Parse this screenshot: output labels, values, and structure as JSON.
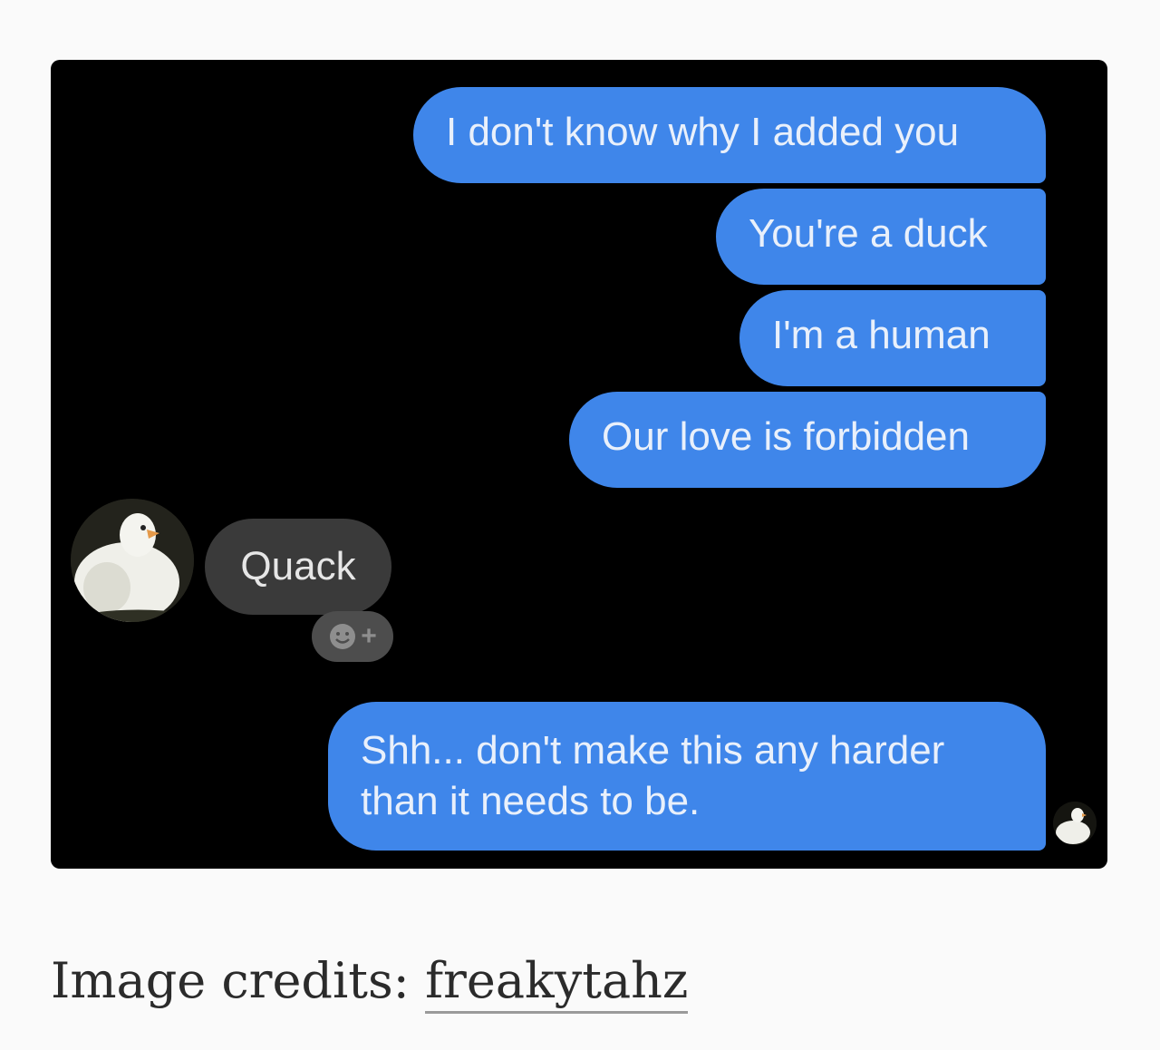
{
  "messages": {
    "outgoing": [
      "I don't know why I added you",
      "You're a duck",
      "I'm a human",
      "Our love is forbidden"
    ],
    "incoming": "Quack",
    "final_outgoing": "Shh... don't make this any harder than it needs to be."
  },
  "icons": {
    "contact_avatar": "duck-avatar-icon",
    "seen_avatar": "duck-seen-icon",
    "reaction": "add-reaction-icon"
  },
  "reaction_plus": "+",
  "caption": {
    "label": "Image credits:",
    "credit": "freakytahz"
  },
  "colors": {
    "outgoing_bubble": "#3f86ea",
    "incoming_bubble": "#3a3a3a",
    "chat_background": "#000000"
  }
}
